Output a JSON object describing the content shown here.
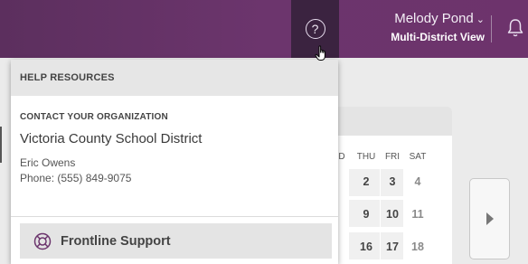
{
  "user": {
    "name": "Melody Pond",
    "context": "Multi-District View"
  },
  "help_menu": {
    "header": "HELP RESOURCES",
    "contact_label": "CONTACT YOUR ORGANIZATION",
    "organization": "Victoria County School District",
    "contact_name": "Eric Owens",
    "contact_phone": "Phone: (555) 849-9075",
    "support_button": "Frontline Support"
  },
  "calendar": {
    "weekdays": [
      "D",
      "THU",
      "FRI",
      "SAT"
    ],
    "rows": [
      [
        "2",
        "3",
        "4"
      ],
      [
        "9",
        "10",
        "11"
      ],
      [
        "16",
        "17",
        "18"
      ]
    ]
  },
  "icons": {
    "help": "help-circle-icon",
    "bell": "bell-icon",
    "support": "lifebuoy-icon",
    "next": "chevron-right-icon",
    "cursor": "hand-pointer-icon"
  },
  "colors": {
    "topbar": "#6c356d",
    "help_active": "#3b2340"
  }
}
